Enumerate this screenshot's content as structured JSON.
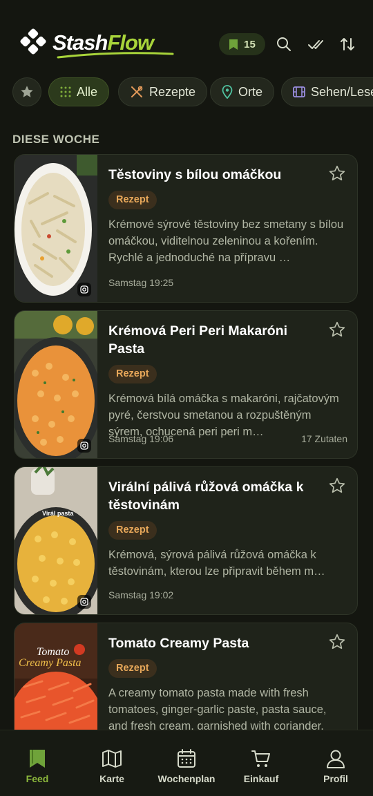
{
  "app": {
    "brand_part1": "Stash",
    "brand_part2": "Flow"
  },
  "header": {
    "saved_count": "15",
    "icons": [
      "bookmark-icon",
      "search-icon",
      "double-check-icon",
      "sort-icon"
    ]
  },
  "filters": [
    {
      "icon": "star-icon",
      "label": ""
    },
    {
      "icon": "grid-icon",
      "label": "Alle",
      "active": true
    },
    {
      "icon": "utensils-icon",
      "label": "Rezepte"
    },
    {
      "icon": "location-pin-icon",
      "label": "Orte"
    },
    {
      "icon": "film-icon",
      "label": "Sehen/Lesen"
    }
  ],
  "section": {
    "title": "DIESE WOCHE"
  },
  "cards": [
    {
      "title": "Těstoviny s bílou omáčkou",
      "badge": "Rezept",
      "description": "Krémové sýrové těstoviny bez smetany s bílou omáčkou, viditelnou zeleninou a kořením. Rychlé a jednoduché na přípravu …",
      "time": "Samstag 19:25",
      "ingredients": "",
      "thumb_caption": ""
    },
    {
      "title": "Krémová Peri Peri Makaróni Pasta",
      "badge": "Rezept",
      "description": "Krémová bílá omáčka s makaróni, rajčatovým pyré, čerstvou smetanou a rozpuštěným sýrem, ochucená peri peri m…",
      "time": "Samstag 19:06",
      "ingredients": "17 Zutaten",
      "thumb_caption": ""
    },
    {
      "title": "Virální pálivá růžová omáčka k těstovinám",
      "badge": "Rezept",
      "description": "Krémová, sýrová pálivá růžová omáčka k těstovinám, kterou lze připravit během m…",
      "time": "Samstag 19:02",
      "ingredients": "",
      "thumb_caption": "Virál pasta"
    },
    {
      "title": "Tomato Creamy Pasta",
      "badge": "Rezept",
      "description": "A creamy tomato pasta made with fresh tomatoes, ginger-garlic paste, pasta sauce, and fresh cream, garnished with coriander.",
      "time": "",
      "ingredients": "",
      "thumb_caption_1": "Tomato",
      "thumb_caption_2": "Creamy Pasta"
    }
  ],
  "nav": [
    {
      "icon": "bookmark-icon",
      "label": "Feed",
      "active": true
    },
    {
      "icon": "map-icon",
      "label": "Karte"
    },
    {
      "icon": "calendar-icon",
      "label": "Wochenplan"
    },
    {
      "icon": "cart-icon",
      "label": "Einkauf"
    },
    {
      "icon": "user-icon",
      "label": "Profil"
    }
  ],
  "colors": {
    "accent": "#8cb83c",
    "background": "#141610",
    "card": "#1f231a",
    "badge_text": "#e8a85a"
  }
}
